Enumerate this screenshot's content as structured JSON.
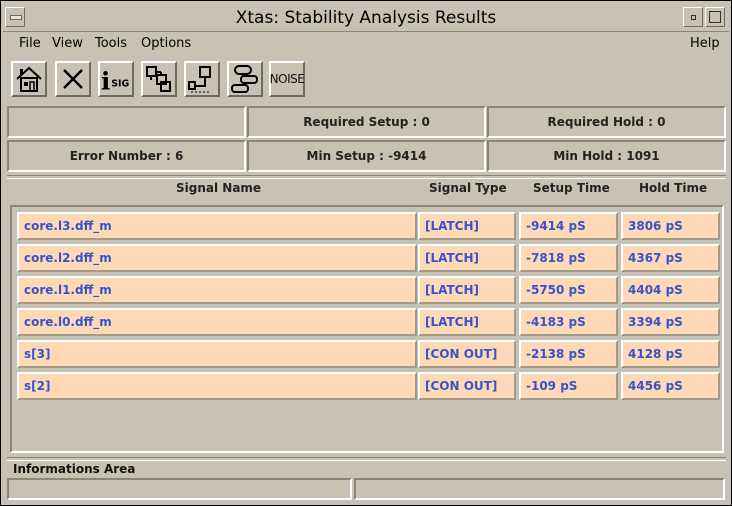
{
  "window": {
    "title": "Xtas: Stability Analysis Results"
  },
  "menu": {
    "file": "File",
    "view": "View",
    "tools": "Tools",
    "options": "Options",
    "help": "Help"
  },
  "toolbar": {
    "noise_label": "NOISE",
    "isig_i": "i",
    "isig_sig": "SIG"
  },
  "summary": {
    "required_setup": "Required Setup : 0",
    "required_hold": "Required Hold : 0",
    "error_number": "Error Number : 6",
    "min_setup": "Min Setup : -9414",
    "min_hold": "Min Hold : 1091"
  },
  "table": {
    "headers": {
      "signal_name": "Signal Name",
      "signal_type": "Signal Type",
      "setup_time": "Setup Time",
      "hold_time": "Hold Time"
    },
    "rows": [
      {
        "name": "core.l3.dff_m",
        "type": "[LATCH]",
        "setup": "-9414 pS",
        "hold": "3806 pS"
      },
      {
        "name": "core.l2.dff_m",
        "type": "[LATCH]",
        "setup": "-7818 pS",
        "hold": "4367 pS"
      },
      {
        "name": "core.l1.dff_m",
        "type": "[LATCH]",
        "setup": "-5750 pS",
        "hold": "4404 pS"
      },
      {
        "name": "core.l0.dff_m",
        "type": "[LATCH]",
        "setup": "-4183 pS",
        "hold": "3394 pS"
      },
      {
        "name": "s[3]",
        "type": "[CON OUT]",
        "setup": "-2138 pS",
        "hold": "4128 pS"
      },
      {
        "name": "s[2]",
        "type": "[CON OUT]",
        "setup": "-109 pS",
        "hold": "4456 pS"
      }
    ]
  },
  "info_area": {
    "label": "Informations Area"
  }
}
